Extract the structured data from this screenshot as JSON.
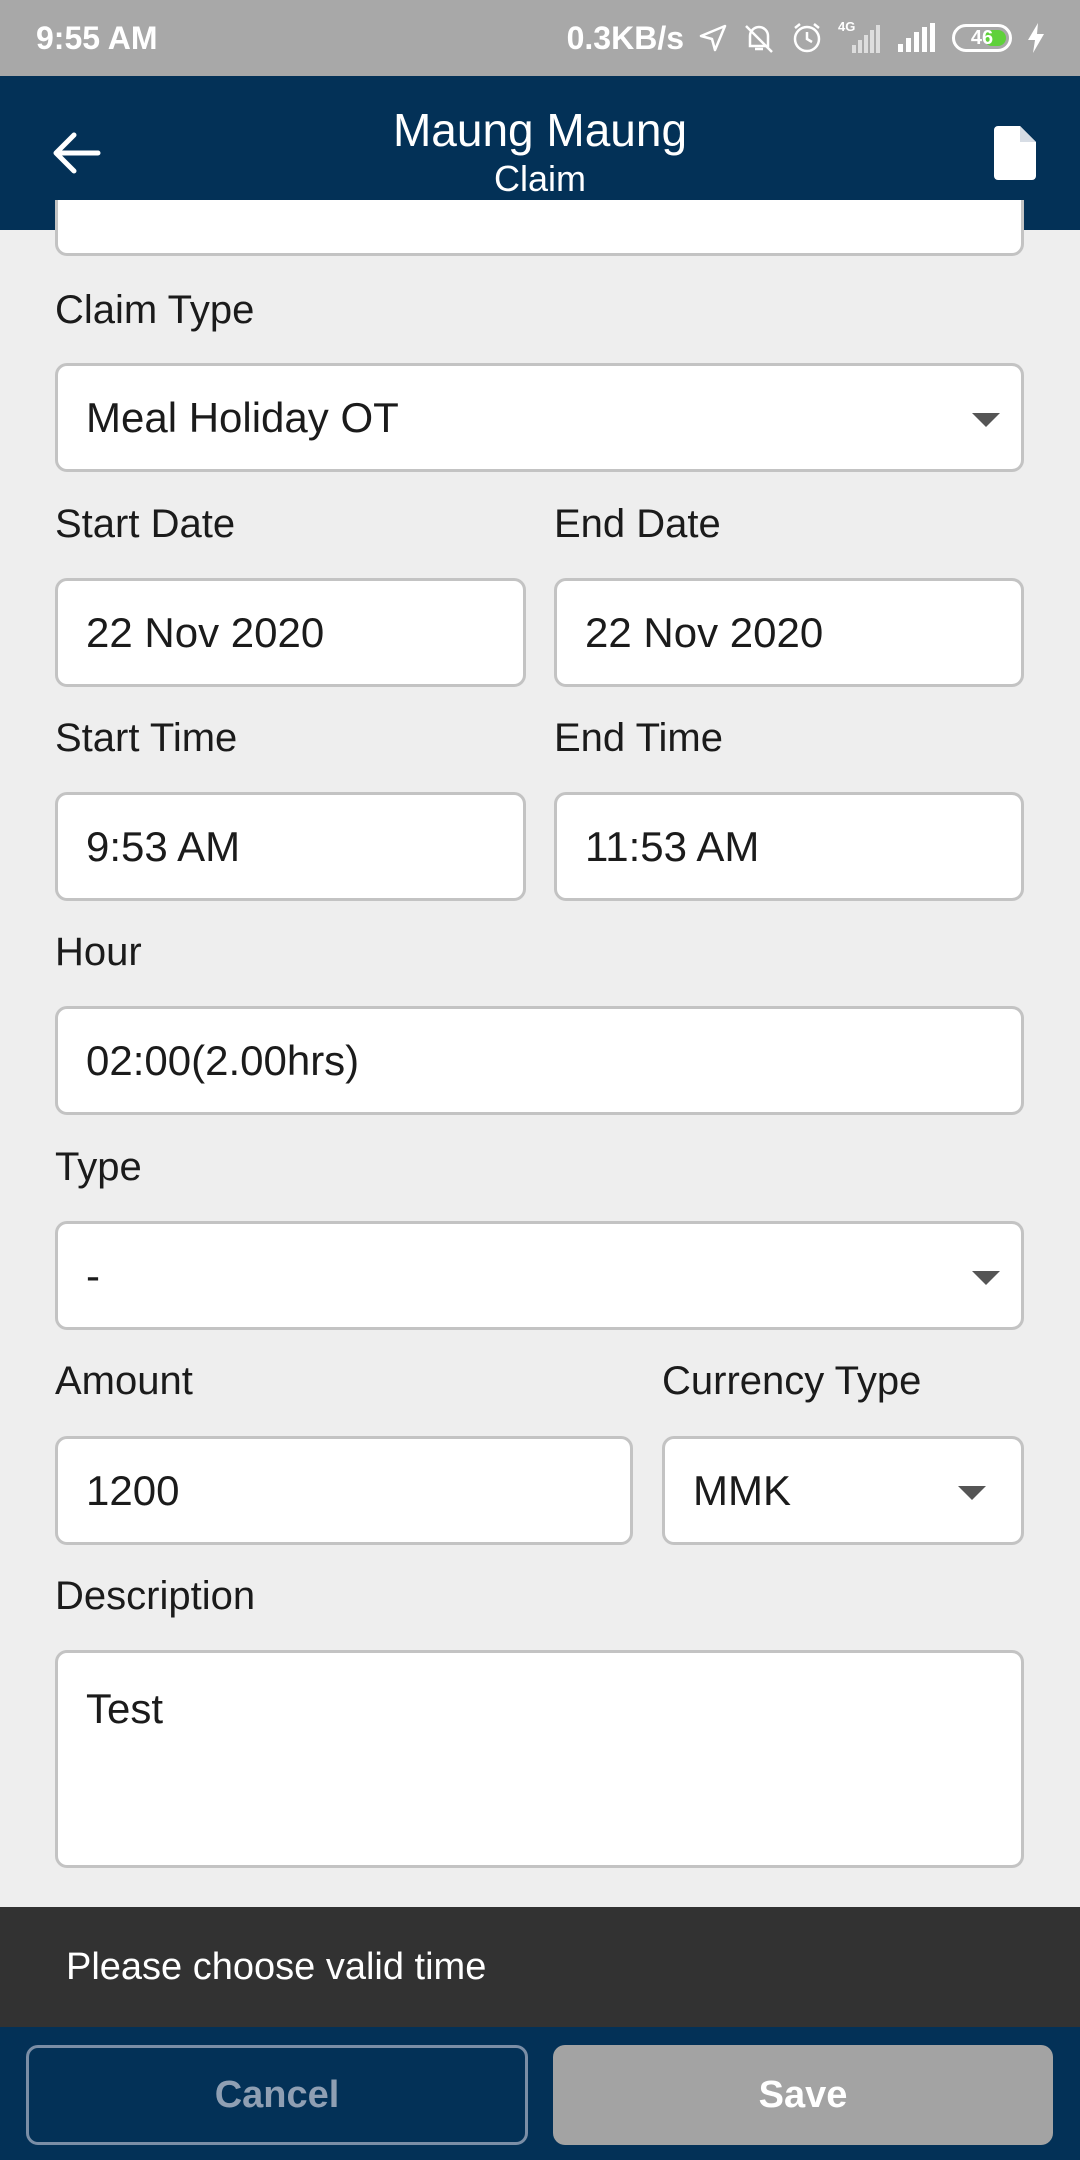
{
  "status_bar": {
    "time": "9:55 AM",
    "network_speed": "0.3KB/s",
    "battery": "46",
    "network_type": "4G",
    "icons": [
      "location-icon",
      "mute-icon",
      "alarm-icon",
      "signal-icon",
      "signal-icon",
      "battery-icon",
      "charging-icon"
    ]
  },
  "app_bar": {
    "title": "Maung Maung",
    "subtitle": "Claim",
    "icons": [
      "back-arrow-icon",
      "document-icon"
    ]
  },
  "form": {
    "claim_type": {
      "label": "Claim Type",
      "value": "Meal Holiday OT"
    },
    "start_date": {
      "label": "Start Date",
      "value": "22 Nov 2020"
    },
    "end_date": {
      "label": "End Date",
      "value": "22 Nov 2020"
    },
    "start_time": {
      "label": "Start Time",
      "value": "9:53 AM"
    },
    "end_time": {
      "label": "End Time",
      "value": "11:53 AM"
    },
    "hour": {
      "label": "Hour",
      "value": "02:00(2.00hrs)"
    },
    "type": {
      "label": "Type",
      "value": "-"
    },
    "amount": {
      "label": "Amount",
      "value": "1200"
    },
    "currency_type": {
      "label": "Currency Type",
      "value": "MMK"
    },
    "description": {
      "label": "Description",
      "value": "Test"
    }
  },
  "snackbar": {
    "message": "Please choose valid time"
  },
  "actions": {
    "cancel_label": "Cancel",
    "save_label": "Save"
  },
  "colors": {
    "app_bar": "#033157",
    "status_bar": "#a8a8a8",
    "background": "#eeeeee",
    "snackbar": "#323232",
    "save_disabled": "#a3a3a3",
    "battery_fill": "#5fd13a"
  }
}
